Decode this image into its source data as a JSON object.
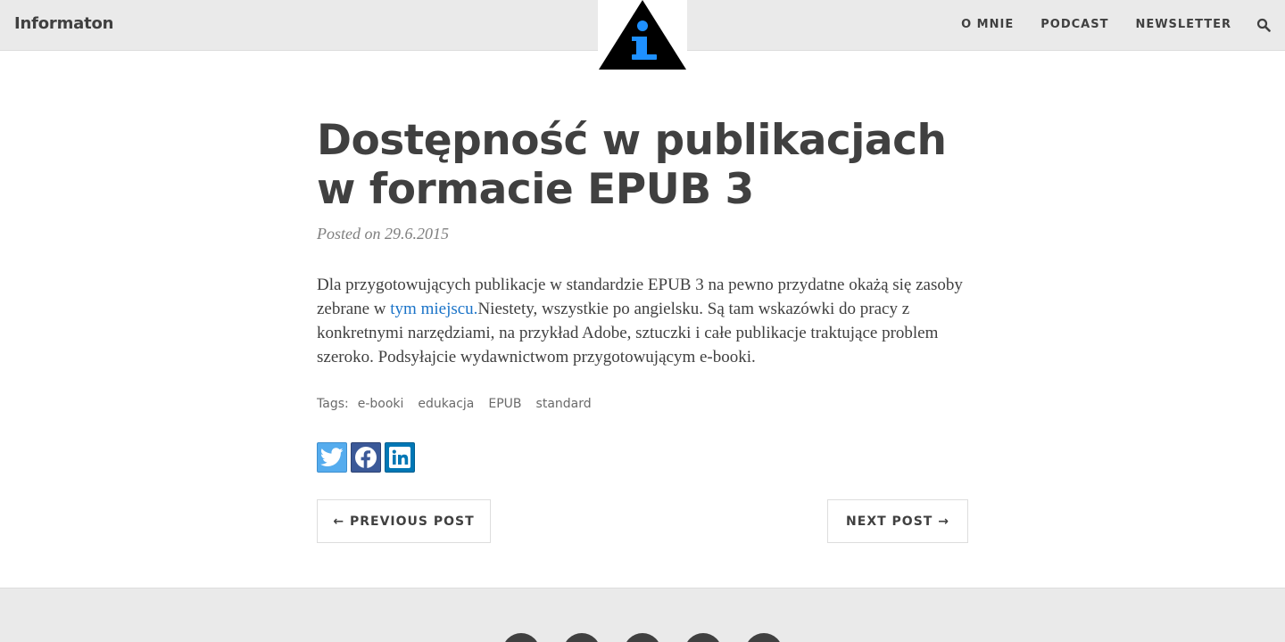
{
  "navbar": {
    "brand": "Informaton",
    "links": [
      "O MNIE",
      "PODCAST",
      "NEWSLETTER"
    ],
    "search_icon": "search-icon",
    "logo_icon": "info-triangle-icon"
  },
  "post": {
    "title_line1": "Dostępność w publikacjach",
    "title_line2": "w formacie EPUB 3",
    "meta": "Posted on 29.6.2015",
    "body_before_link": "Dla przygotowujących publikacje w standardzie EPUB 3 na pewno przydatne okażą się zasoby zebrane w ",
    "body_link": "tym miejscu.",
    "body_after_link": "Niestety, wszystkie po angielsku. Są tam wskazówki do pracy z konkretnymi narzędziami, na przykład Adobe, sztuczki i całe publikacje traktujące problem szeroko. Podsyłajcie wydawnictwom przygotowującym e-booki.",
    "tags_label": "Tags:",
    "tags": [
      "e-booki",
      "edukacja",
      "EPUB",
      "standard"
    ],
    "share": [
      "twitter-icon",
      "facebook-icon",
      "linkedin-icon"
    ]
  },
  "pager": {
    "previous": "← PREVIOUS POST",
    "next": "NEXT POST →"
  },
  "footer": {
    "social_icons": [
      "social-icon",
      "social-icon",
      "social-icon",
      "social-icon",
      "social-icon"
    ]
  },
  "colors": {
    "link": "#1a73c8",
    "logo_blue": "#1e90ff",
    "navbar_bg": "#eaeaea",
    "text": "#404040"
  }
}
